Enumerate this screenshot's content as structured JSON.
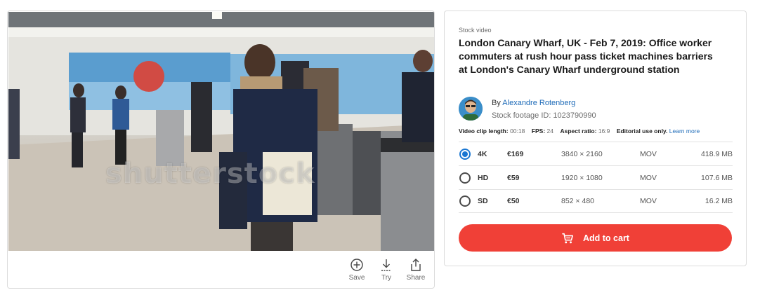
{
  "media": {
    "watermark": "shutterstock",
    "actions": [
      {
        "icon": "plus-circle-icon",
        "label": "Save"
      },
      {
        "icon": "download-icon",
        "label": "Try"
      },
      {
        "icon": "share-icon",
        "label": "Share"
      }
    ]
  },
  "info": {
    "eyebrow": "Stock video",
    "title": "London Canary Wharf, UK - Feb 7, 2019: Office worker commuters at rush hour pass ticket machines barriers at London's Canary Wharf underground station",
    "by_prefix": "By",
    "author": "Alexandre Rotenberg",
    "footage_id": "Stock footage ID: 1023790990",
    "meta": {
      "length_label": "Video clip length:",
      "length_value": "00:18",
      "fps_label": "FPS:",
      "fps_value": "24",
      "aspect_label": "Aspect ratio:",
      "aspect_value": "16:9",
      "editorial": "Editorial use only.",
      "learn_more": "Learn more"
    }
  },
  "options": [
    {
      "res": "4K",
      "price": "€169",
      "dims": "3840 × 2160",
      "format": "MOV",
      "size": "418.9 MB",
      "selected": true
    },
    {
      "res": "HD",
      "price": "€59",
      "dims": "1920 × 1080",
      "format": "MOV",
      "size": "107.6 MB",
      "selected": false
    },
    {
      "res": "SD",
      "price": "€50",
      "dims": "852 × 480",
      "format": "MOV",
      "size": "16.2 MB",
      "selected": false
    }
  ],
  "cart": {
    "label": "Add to cart"
  },
  "colors": {
    "accent": "#f04037",
    "link": "#1e6bb8",
    "radio": "#1976d2"
  }
}
